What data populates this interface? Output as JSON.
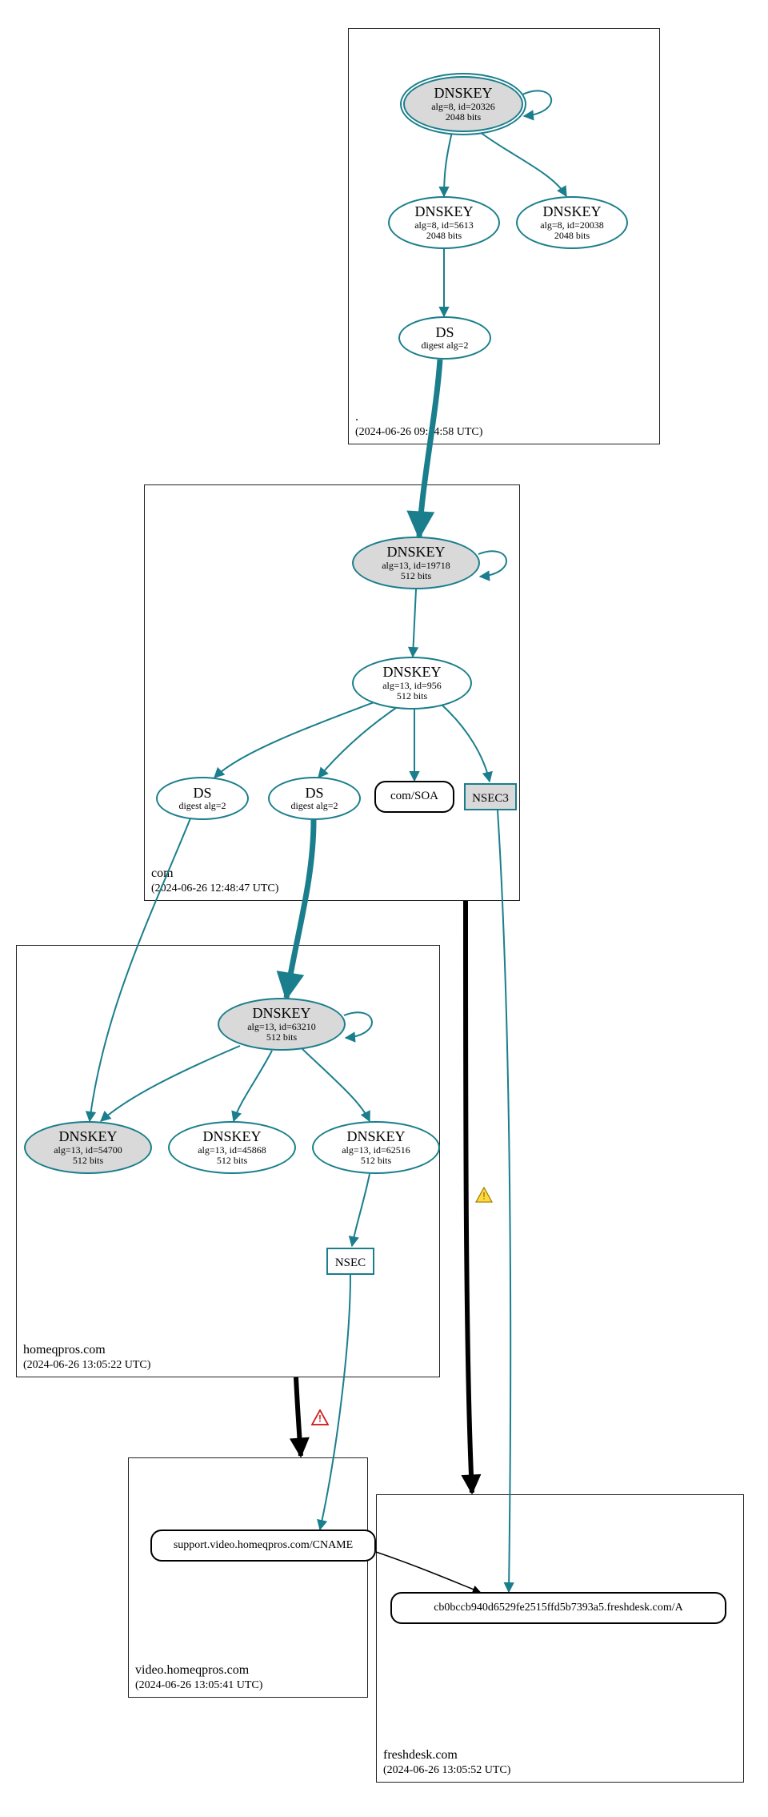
{
  "colors": {
    "teal": "#1a7e8c",
    "black": "#000000",
    "grey": "#d9d9d9"
  },
  "zones": {
    "root": {
      "name": ".",
      "ts": "(2024-06-26 09:54:58 UTC)"
    },
    "com": {
      "name": "com",
      "ts": "(2024-06-26 12:48:47 UTC)"
    },
    "homeqpros": {
      "name": "homeqpros.com",
      "ts": "(2024-06-26 13:05:22 UTC)"
    },
    "video": {
      "name": "video.homeqpros.com",
      "ts": "(2024-06-26 13:05:41 UTC)"
    },
    "freshdesk": {
      "name": "freshdesk.com",
      "ts": "(2024-06-26 13:05:52 UTC)"
    }
  },
  "nodes": {
    "root_ksk": {
      "title": "DNSKEY",
      "l1": "alg=8, id=20326",
      "l2": "2048 bits"
    },
    "root_zsk1": {
      "title": "DNSKEY",
      "l1": "alg=8, id=5613",
      "l2": "2048 bits"
    },
    "root_zsk2": {
      "title": "DNSKEY",
      "l1": "alg=8, id=20038",
      "l2": "2048 bits"
    },
    "root_ds": {
      "title": "DS",
      "l1": "digest alg=2",
      "l2": ""
    },
    "com_ksk": {
      "title": "DNSKEY",
      "l1": "alg=13, id=19718",
      "l2": "512 bits"
    },
    "com_zsk": {
      "title": "DNSKEY",
      "l1": "alg=13, id=956",
      "l2": "512 bits"
    },
    "com_ds1": {
      "title": "DS",
      "l1": "digest alg=2",
      "l2": ""
    },
    "com_ds2": {
      "title": "DS",
      "l1": "digest alg=2",
      "l2": ""
    },
    "com_soa": {
      "title": "com/SOA",
      "l1": "",
      "l2": ""
    },
    "com_nsec3": {
      "title": "NSEC3",
      "l1": "",
      "l2": ""
    },
    "hq_ksk": {
      "title": "DNSKEY",
      "l1": "alg=13, id=63210",
      "l2": "512 bits"
    },
    "hq_k1": {
      "title": "DNSKEY",
      "l1": "alg=13, id=54700",
      "l2": "512 bits"
    },
    "hq_k2": {
      "title": "DNSKEY",
      "l1": "alg=13, id=45868",
      "l2": "512 bits"
    },
    "hq_k3": {
      "title": "DNSKEY",
      "l1": "alg=13, id=62516",
      "l2": "512 bits"
    },
    "hq_nsec": {
      "title": "NSEC",
      "l1": "",
      "l2": ""
    },
    "cname": {
      "title": "support.video.homeqpros.com/CNAME",
      "l1": "",
      "l2": ""
    },
    "a_rec": {
      "title": "cb0bccb940d6529fe2515ffd5b7393a5.freshdesk.com/A",
      "l1": "",
      "l2": ""
    }
  },
  "chart_data": {
    "type": "graph",
    "description": "DNSSEC delegation / signing graph from DNSViz",
    "zones": [
      {
        "id": "root",
        "name": ".",
        "timestamp": "2024-06-26 09:54:58 UTC"
      },
      {
        "id": "com",
        "name": "com",
        "timestamp": "2024-06-26 12:48:47 UTC"
      },
      {
        "id": "homeqpros",
        "name": "homeqpros.com",
        "timestamp": "2024-06-26 13:05:22 UTC"
      },
      {
        "id": "video",
        "name": "video.homeqpros.com",
        "timestamp": "2024-06-26 13:05:41 UTC"
      },
      {
        "id": "freshdesk",
        "name": "freshdesk.com",
        "timestamp": "2024-06-26 13:05:52 UTC"
      }
    ],
    "nodes": [
      {
        "id": "root_ksk",
        "zone": "root",
        "type": "DNSKEY",
        "alg": 8,
        "key_id": 20326,
        "bits": 2048,
        "role": "KSK",
        "trust_anchor": true
      },
      {
        "id": "root_zsk1",
        "zone": "root",
        "type": "DNSKEY",
        "alg": 8,
        "key_id": 5613,
        "bits": 2048
      },
      {
        "id": "root_zsk2",
        "zone": "root",
        "type": "DNSKEY",
        "alg": 8,
        "key_id": 20038,
        "bits": 2048
      },
      {
        "id": "root_ds",
        "zone": "root",
        "type": "DS",
        "digest_alg": 2,
        "for_zone": "com"
      },
      {
        "id": "com_ksk",
        "zone": "com",
        "type": "DNSKEY",
        "alg": 13,
        "key_id": 19718,
        "bits": 512,
        "role": "KSK"
      },
      {
        "id": "com_zsk",
        "zone": "com",
        "type": "DNSKEY",
        "alg": 13,
        "key_id": 956,
        "bits": 512
      },
      {
        "id": "com_ds1",
        "zone": "com",
        "type": "DS",
        "digest_alg": 2,
        "for_zone": "homeqpros.com"
      },
      {
        "id": "com_ds2",
        "zone": "com",
        "type": "DS",
        "digest_alg": 2,
        "for_zone": "homeqpros.com"
      },
      {
        "id": "com_soa",
        "zone": "com",
        "type": "SOA",
        "owner": "com"
      },
      {
        "id": "com_nsec3",
        "zone": "com",
        "type": "NSEC3"
      },
      {
        "id": "hq_ksk",
        "zone": "homeqpros",
        "type": "DNSKEY",
        "alg": 13,
        "key_id": 63210,
        "bits": 512,
        "role": "KSK"
      },
      {
        "id": "hq_k1",
        "zone": "homeqpros",
        "type": "DNSKEY",
        "alg": 13,
        "key_id": 54700,
        "bits": 512
      },
      {
        "id": "hq_k2",
        "zone": "homeqpros",
        "type": "DNSKEY",
        "alg": 13,
        "key_id": 45868,
        "bits": 512
      },
      {
        "id": "hq_k3",
        "zone": "homeqpros",
        "type": "DNSKEY",
        "alg": 13,
        "key_id": 62516,
        "bits": 512
      },
      {
        "id": "hq_nsec",
        "zone": "homeqpros",
        "type": "NSEC"
      },
      {
        "id": "cname",
        "zone": "video",
        "type": "CNAME",
        "owner": "support.video.homeqpros.com"
      },
      {
        "id": "a_rec",
        "zone": "freshdesk",
        "type": "A",
        "owner": "cb0bccb940d6529fe2515ffd5b7393a5.freshdesk.com"
      }
    ],
    "edges": [
      {
        "from": "root_ksk",
        "to": "root_ksk",
        "kind": "self-sign",
        "style": "teal-thin"
      },
      {
        "from": "root_ksk",
        "to": "root_zsk1",
        "kind": "signs",
        "style": "teal-thin"
      },
      {
        "from": "root_ksk",
        "to": "root_zsk2",
        "kind": "signs",
        "style": "teal-thin"
      },
      {
        "from": "root_zsk1",
        "to": "root_ds",
        "kind": "signs",
        "style": "teal-thin"
      },
      {
        "from": "root_ds",
        "to": "com_ksk",
        "kind": "delegation",
        "style": "teal-thick"
      },
      {
        "from": "com_ksk",
        "to": "com_ksk",
        "kind": "self-sign",
        "style": "teal-thin"
      },
      {
        "from": "com_ksk",
        "to": "com_zsk",
        "kind": "signs",
        "style": "teal-thin"
      },
      {
        "from": "com_zsk",
        "to": "com_ds1",
        "kind": "signs",
        "style": "teal-thin"
      },
      {
        "from": "com_zsk",
        "to": "com_ds2",
        "kind": "signs",
        "style": "teal-thin"
      },
      {
        "from": "com_zsk",
        "to": "com_soa",
        "kind": "signs",
        "style": "teal-thin"
      },
      {
        "from": "com_zsk",
        "to": "com_nsec3",
        "kind": "signs",
        "style": "teal-thin"
      },
      {
        "from": "com_ds1",
        "to": "hq_k1",
        "kind": "delegation",
        "style": "teal-thin"
      },
      {
        "from": "com_ds2",
        "to": "hq_ksk",
        "kind": "delegation",
        "style": "teal-thick"
      },
      {
        "from": "hq_ksk",
        "to": "hq_ksk",
        "kind": "self-sign",
        "style": "teal-thin"
      },
      {
        "from": "hq_ksk",
        "to": "hq_k1",
        "kind": "signs",
        "style": "teal-thin"
      },
      {
        "from": "hq_ksk",
        "to": "hq_k2",
        "kind": "signs",
        "style": "teal-thin"
      },
      {
        "from": "hq_ksk",
        "to": "hq_k3",
        "kind": "signs",
        "style": "teal-thin"
      },
      {
        "from": "hq_k3",
        "to": "hq_nsec",
        "kind": "signs",
        "style": "teal-thin"
      },
      {
        "from": "hq_nsec",
        "to": "cname",
        "kind": "covers",
        "style": "teal-thin"
      },
      {
        "from": "homeqpros",
        "to": "video",
        "kind": "insecure-delegation",
        "style": "black-thick",
        "status": "error"
      },
      {
        "from": "com_nsec3",
        "to": "a_rec",
        "kind": "covers",
        "style": "teal-thin"
      },
      {
        "from": "com",
        "to": "freshdesk",
        "kind": "insecure-delegation",
        "style": "black-thick",
        "status": "warning"
      },
      {
        "from": "cname",
        "to": "a_rec",
        "kind": "alias",
        "style": "black-thin"
      }
    ]
  }
}
